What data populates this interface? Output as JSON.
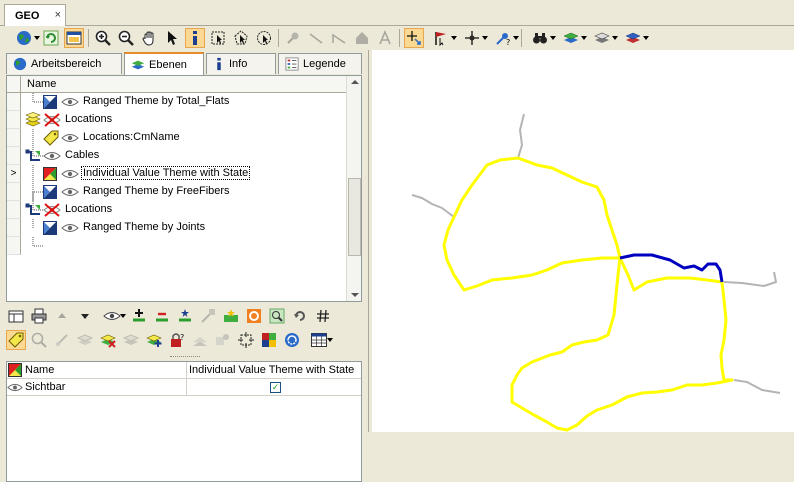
{
  "document_tab": {
    "label": "GEO",
    "close": "×"
  },
  "panel_tabs": [
    {
      "label": "Arbeitsbereich",
      "icon": "globe-icon"
    },
    {
      "label": "Ebenen",
      "icon": "layers-icon"
    },
    {
      "label": "Info",
      "icon": "info-icon"
    },
    {
      "label": "Legende",
      "icon": "legend-icon"
    }
  ],
  "tree": {
    "column_header": "Name",
    "rows": [
      {
        "label": "Ranged Theme by Total_Flats",
        "level": 2
      },
      {
        "label": "Locations",
        "level": 1
      },
      {
        "label": "Locations:CmName",
        "level": 2
      },
      {
        "label": "Cables",
        "level": 1
      },
      {
        "label": "Individual Value Theme with State",
        "level": 2,
        "selected": true,
        "row_header": ">"
      },
      {
        "label": "Ranged Theme by FreeFibers",
        "level": 2
      },
      {
        "label": "Locations",
        "level": 1
      },
      {
        "label": "Ranged Theme by Joints",
        "level": 2
      }
    ]
  },
  "properties": {
    "rows": [
      {
        "name": "Name",
        "value": "Individual Value Theme with State"
      },
      {
        "name": "Sichtbar",
        "value": "✓"
      }
    ]
  },
  "colors": {
    "cable_yellow": "#ffff00",
    "cable_blue": "#0000c0",
    "cable_grey": "#b4b4b4",
    "active_tool": "#fbd993"
  }
}
